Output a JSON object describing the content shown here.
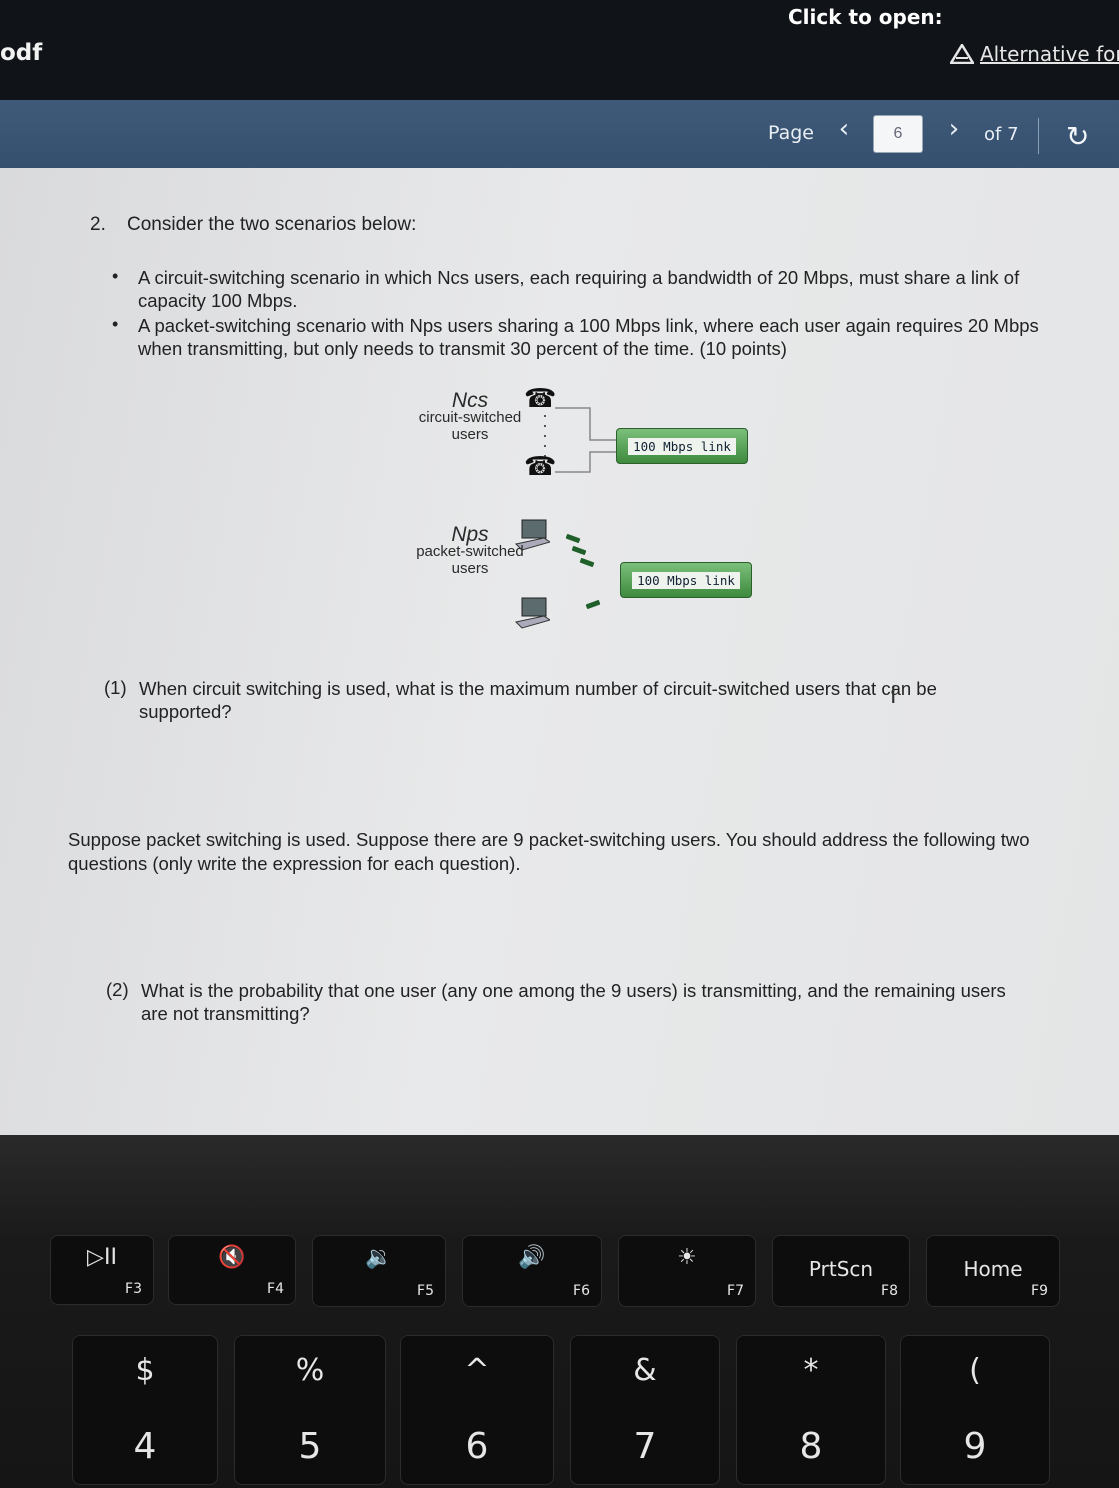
{
  "viewer": {
    "file_label": "odf",
    "click_to_open": "Click to open:",
    "alternative_formats": "Alternative forr",
    "page_label": "Page",
    "page_number": "6",
    "page_total": "of 7"
  },
  "document": {
    "question_number": "2.",
    "intro": "Consider the two scenarios below:",
    "bullets": [
      "A circuit-switching scenario in which Ncs users, each requiring a bandwidth of 20 Mbps, must share a link of capacity 100 Mbps.",
      "A packet-switching scenario with Nps users sharing a 100 Mbps link, where each user again requires 20 Mbps when transmitting, but only needs to transmit 30 percent of the time. (10 points)"
    ],
    "diagram": {
      "cs_symbol": "Ncs",
      "cs_label_1": "circuit-switched",
      "cs_label_2": "users",
      "ps_symbol": "Nps",
      "ps_label_1": "packet-switched",
      "ps_label_2": "users",
      "link_1": "100 Mbps link",
      "link_2": "100 Mbps link"
    },
    "q1_number": "(1)",
    "q1_text": "When circuit switching is used, what is the maximum number of circuit-switched users that can be supported?",
    "suppose_text": "Suppose packet switching is used. Suppose there are 9 packet-switching users. You should address the following two questions (only write the expression for each question).",
    "q2_number": "(2)",
    "q2_text": "What is the probability that one user (any one among the 9 users) is transmitting, and the remaining users are not transmitting?"
  },
  "keyboard": {
    "fn_keys": [
      {
        "icon": "play-pause",
        "glyph": "▷II",
        "label": "F3"
      },
      {
        "icon": "mute",
        "glyph": "🔇",
        "label": "F4"
      },
      {
        "icon": "volume-down",
        "glyph": "🔉",
        "label": "F5"
      },
      {
        "icon": "volume-up",
        "glyph": "🔊",
        "label": "F6"
      },
      {
        "icon": "brightness",
        "glyph": "☀",
        "label": "F7"
      },
      {
        "icon": "",
        "glyph": "PrtScn",
        "label": "F8"
      },
      {
        "icon": "",
        "glyph": "Home",
        "label": "F9"
      }
    ],
    "num_keys": [
      {
        "top": "$",
        "bottom": "4"
      },
      {
        "top": "%",
        "bottom": "5"
      },
      {
        "top": "^",
        "bottom": "6"
      },
      {
        "top": "&",
        "bottom": "7"
      },
      {
        "top": "*",
        "bottom": "8"
      },
      {
        "top": "(",
        "bottom": "9"
      }
    ]
  }
}
